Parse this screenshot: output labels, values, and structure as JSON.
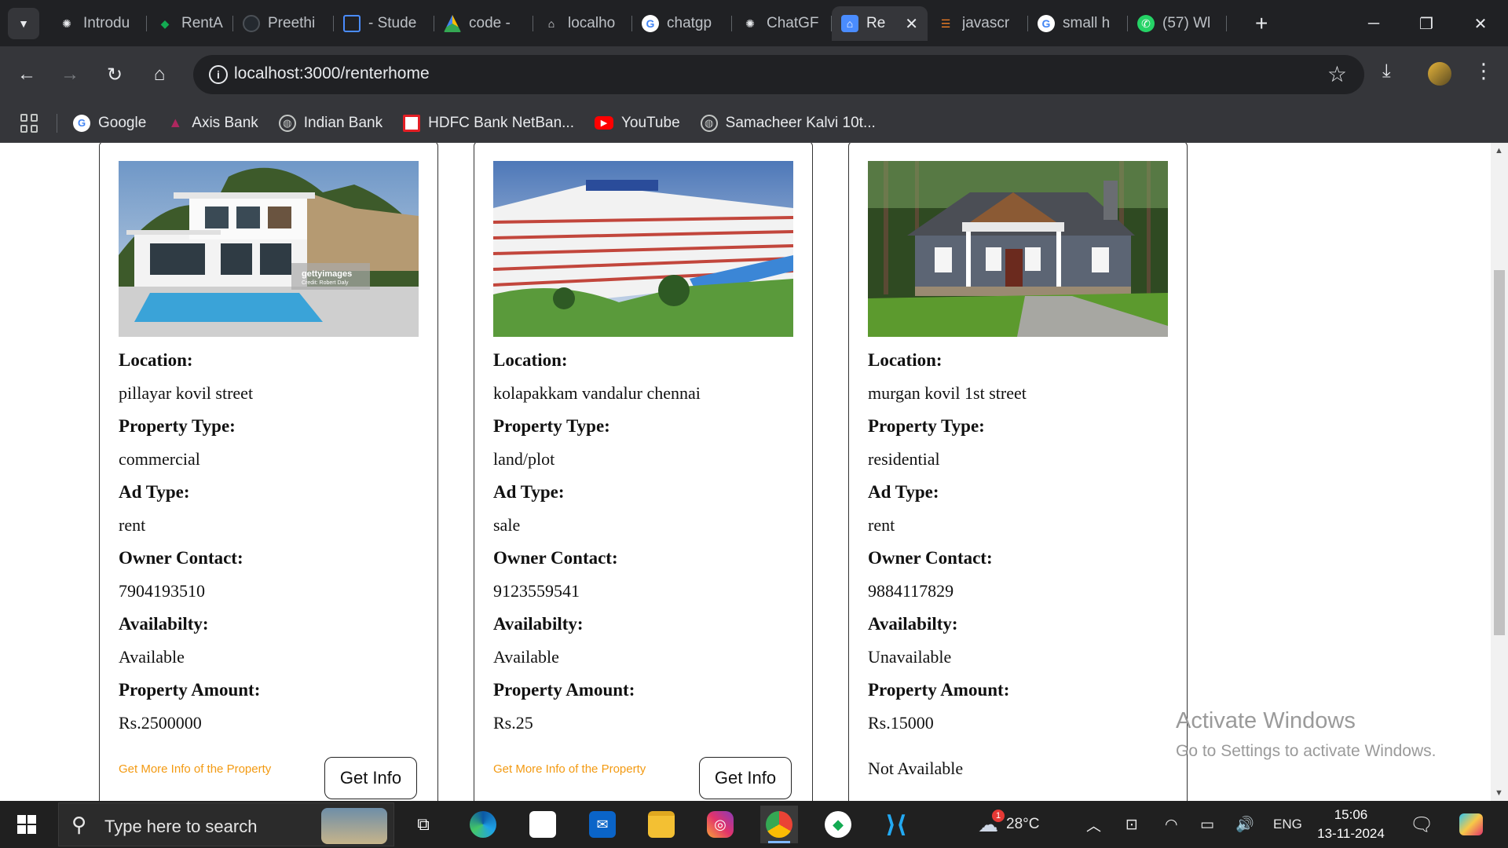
{
  "browser": {
    "tabs": [
      {
        "label": "Introdu",
        "icon": "openai-icon",
        "active": false
      },
      {
        "label": "RentAp",
        "icon": "mongodb-icon",
        "active": false
      },
      {
        "label": "Preethi",
        "icon": "github-icon",
        "active": false
      },
      {
        "label": "- Stude",
        "icon": "screen-icon",
        "active": false
      },
      {
        "label": "code -",
        "icon": "google-drive-icon",
        "active": false
      },
      {
        "label": "localho",
        "icon": "home-icon",
        "active": false
      },
      {
        "label": "chatgp",
        "icon": "google-icon",
        "active": false
      },
      {
        "label": "ChatGF",
        "icon": "openai-icon",
        "active": false
      },
      {
        "label": "Re",
        "icon": "home-icon",
        "active": true
      },
      {
        "label": "javascr",
        "icon": "stackoverflow-icon",
        "active": false
      },
      {
        "label": "small h",
        "icon": "google-icon",
        "active": false
      },
      {
        "label": "(57) Wl",
        "icon": "whatsapp-icon",
        "active": false
      }
    ],
    "new_tab": "+",
    "url": "localhost:3000/renterhome",
    "bookmarks": [
      {
        "label": "Google",
        "icon": "google-icon"
      },
      {
        "label": "Axis Bank",
        "icon": "axis-bank-icon"
      },
      {
        "label": "Indian Bank",
        "icon": "globe-icon"
      },
      {
        "label": "HDFC Bank NetBan...",
        "icon": "hdfc-icon"
      },
      {
        "label": "YouTube",
        "icon": "youtube-icon"
      },
      {
        "label": "Samacheer Kalvi 10t...",
        "icon": "globe-icon"
      }
    ]
  },
  "labels": {
    "location": "Location:",
    "property_type": "Property Type:",
    "ad_type": "Ad Type:",
    "owner_contact": "Owner Contact:",
    "availability": "Availabilty:",
    "amount": "Property Amount:",
    "more_info": "Get More Info of the Property",
    "get_info": "Get Info"
  },
  "properties": [
    {
      "location": "pillayar kovil street",
      "property_type": "commercial",
      "ad_type": "rent",
      "owner_contact": "7904193510",
      "availability": "Available",
      "amount": "Rs.2500000",
      "image_caption": "gettyimages",
      "image_credit": "Credit: Robert Daly"
    },
    {
      "location": "kolapakkam vandalur chennai",
      "property_type": "land/plot",
      "ad_type": "sale",
      "owner_contact": "9123559541",
      "availability": "Available",
      "amount": "Rs.25"
    },
    {
      "location": "murgan kovil 1st street",
      "property_type": "residential",
      "ad_type": "rent",
      "owner_contact": "9884117829",
      "availability": "Unavailable",
      "amount": "Rs.15000",
      "status": "Not Available"
    }
  ],
  "watermark": {
    "title": "Activate Windows",
    "subtitle": "Go to Settings to activate Windows."
  },
  "taskbar": {
    "search_placeholder": "Type here to search",
    "weather": "28°C",
    "weather_badge": "1",
    "language": "ENG",
    "time": "15:06",
    "date": "13-11-2024"
  },
  "colors": {
    "accent_link": "#f39a12",
    "chrome_dark": "#202124",
    "chrome_toolbar": "#35363a"
  }
}
